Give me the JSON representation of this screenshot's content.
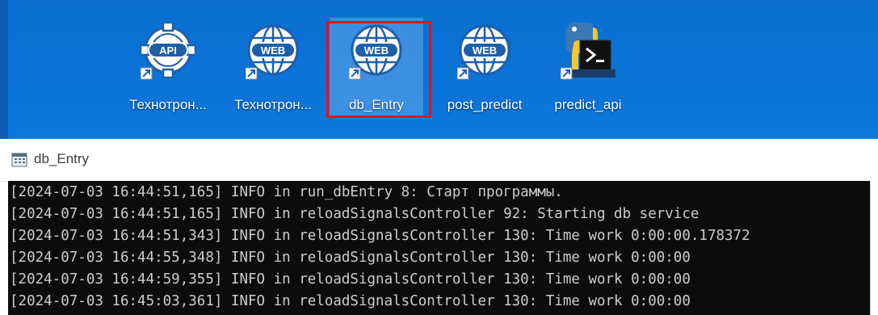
{
  "desktop": {
    "icons": [
      {
        "label": "Технотрон...",
        "badge": "API",
        "icon": "api-gear-shortcut-icon"
      },
      {
        "label": "Технотрон...",
        "badge": "WEB",
        "icon": "web-globe-shortcut-icon"
      },
      {
        "label": "db_Entry",
        "badge": "WEB",
        "icon": "web-globe-shortcut-icon",
        "selected": true
      },
      {
        "label": "post_predict",
        "badge": "WEB",
        "icon": "web-globe-shortcut-icon"
      },
      {
        "label": "predict_api",
        "badge": "",
        "icon": "python-shortcut-icon"
      }
    ],
    "selection_color": "#e8101a"
  },
  "window": {
    "title": "db_Entry",
    "icon": "console-window-icon"
  },
  "console": {
    "lines": [
      "[2024-07-03 16:44:51,165] INFO in run_dbEntry 8: Старт программы.",
      "[2024-07-03 16:44:51,165] INFO in reloadSignalsController 92: Starting db service",
      "[2024-07-03 16:44:51,343] INFO in reloadSignalsController 130: Time work 0:00:00.178372",
      "[2024-07-03 16:44:55,348] INFO in reloadSignalsController 130: Time work 0:00:00",
      "[2024-07-03 16:44:59,355] INFO in reloadSignalsController 130: Time work 0:00:00",
      "[2024-07-03 16:45:03,361] INFO in reloadSignalsController 130: Time work 0:00:00"
    ]
  }
}
